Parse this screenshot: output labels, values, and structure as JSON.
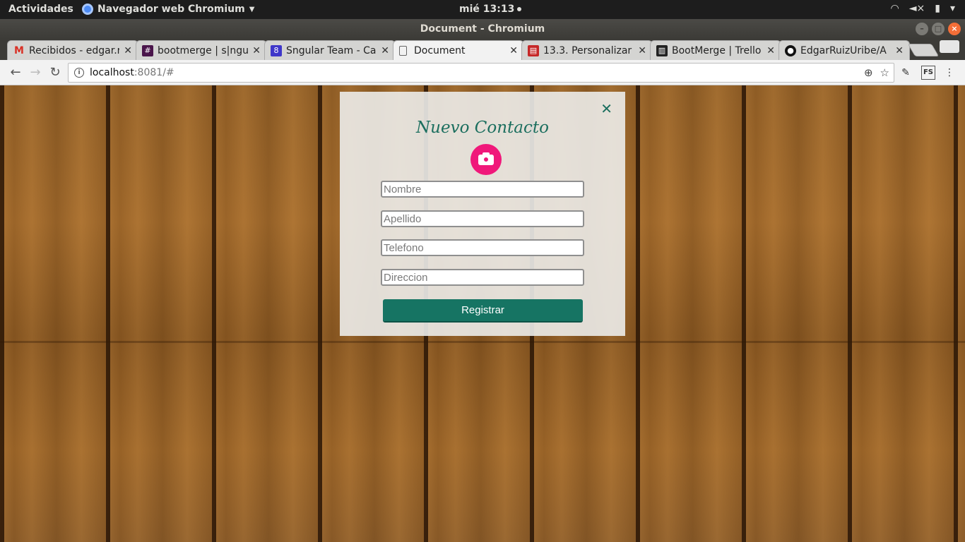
{
  "system_bar": {
    "activities": "Actividades",
    "app_name": "Navegador web Chromium",
    "clock": "mié 13:13"
  },
  "window": {
    "title": "Document - Chromium"
  },
  "tabs": [
    {
      "title": "Recibidos - edgar.r",
      "favicon": "gmail-icon",
      "color": "#d93025"
    },
    {
      "title": "bootmerge | s|ngu",
      "favicon": "slack-icon",
      "color": "#4a154b"
    },
    {
      "title": "Sngular Team - Cal",
      "favicon": "calendar-icon",
      "color": "#3f37c9"
    },
    {
      "title": "Document",
      "favicon": "document-icon",
      "color": "#ffffff"
    },
    {
      "title": "13.3. Personalizar",
      "favicon": "book-icon",
      "color": "#c62828"
    },
    {
      "title": "BootMerge | Trello",
      "favicon": "trello-icon",
      "color": "#222222"
    },
    {
      "title": "EdgarRuizUribe/A",
      "favicon": "github-icon",
      "color": "#111111"
    }
  ],
  "address_bar": {
    "host": "localhost",
    "rest": ":8081/#"
  },
  "extensions": {
    "fs_label": "FS"
  },
  "form": {
    "title": "Nuevo Contacto",
    "fields": {
      "nombre_placeholder": "Nombre",
      "apellido_placeholder": "Apellido",
      "telefono_placeholder": "Telefono",
      "direccion_placeholder": "Direccion"
    },
    "submit_label": "Registrar",
    "accent_color": "#167463",
    "camera_color": "#f0187a"
  }
}
